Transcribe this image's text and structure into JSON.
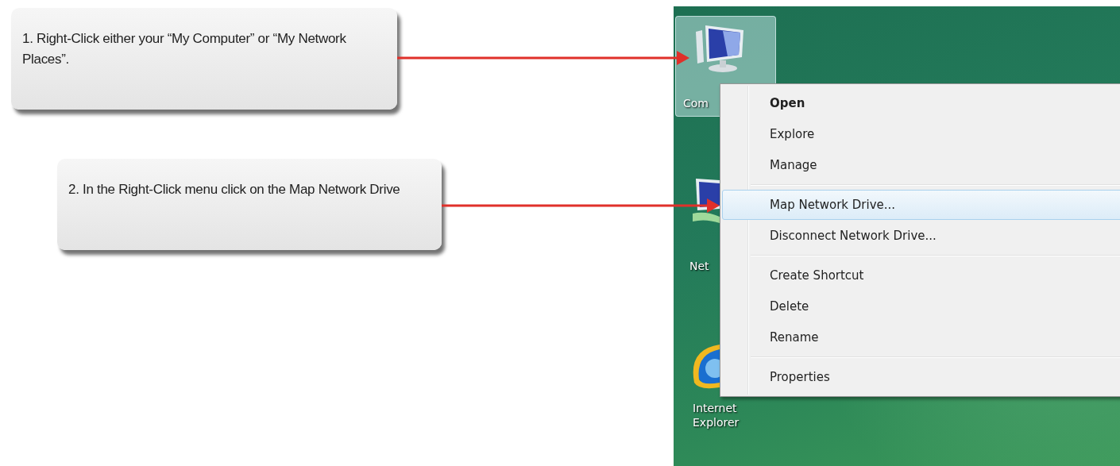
{
  "callouts": [
    {
      "text": "1. Right-Click either your “My Computer” or “My Network Places”."
    },
    {
      "text": "2. In the Right-Click menu click on the Map Network Drive"
    }
  ],
  "desktop": {
    "icons": [
      {
        "kind": "computer",
        "label": "Com",
        "selected": true
      },
      {
        "kind": "network",
        "label": "Net",
        "selected": false
      },
      {
        "kind": "browser",
        "label": "Internet Explorer",
        "selected": false
      }
    ]
  },
  "context_menu": {
    "groups": [
      [
        {
          "label": "Open",
          "default": true,
          "selected": false
        },
        {
          "label": "Explore",
          "default": false,
          "selected": false
        },
        {
          "label": "Manage",
          "default": false,
          "selected": false
        }
      ],
      [
        {
          "label": "Map Network Drive...",
          "default": false,
          "selected": true
        },
        {
          "label": "Disconnect Network Drive...",
          "default": false,
          "selected": false
        }
      ],
      [
        {
          "label": "Create Shortcut",
          "default": false,
          "selected": false
        },
        {
          "label": "Delete",
          "default": false,
          "selected": false
        },
        {
          "label": "Rename",
          "default": false,
          "selected": false
        }
      ],
      [
        {
          "label": "Properties",
          "default": false,
          "selected": false
        }
      ]
    ]
  }
}
